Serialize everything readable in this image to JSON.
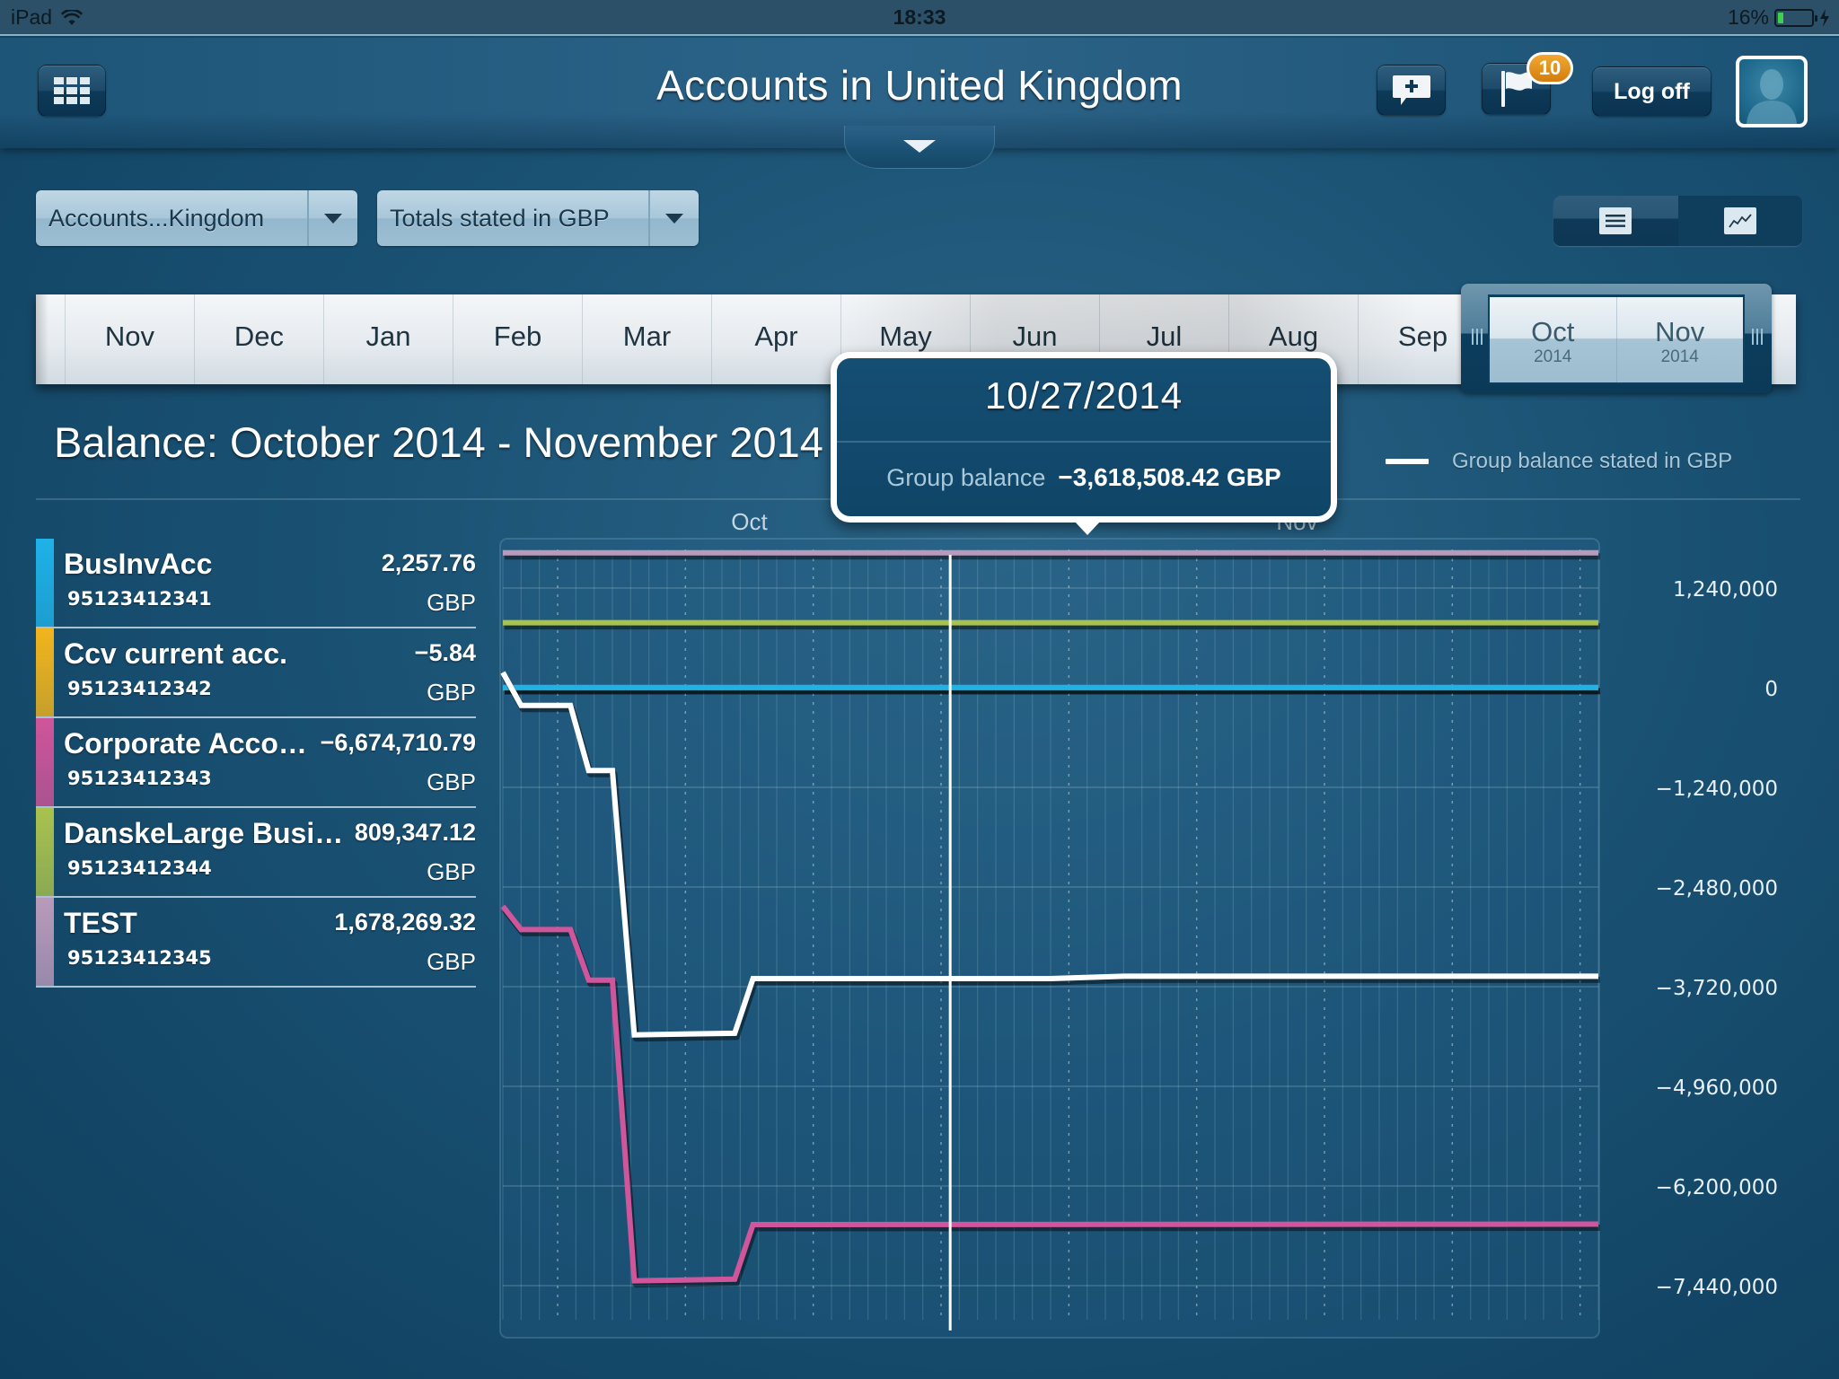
{
  "status_bar": {
    "device": "iPad",
    "time": "18:33",
    "battery_percent_label": "16%",
    "battery_level": 0.16
  },
  "header": {
    "title": "Accounts in United Kingdom",
    "menu_icon": "grid-menu-icon",
    "new_message_icon": "comment-plus-icon",
    "flag_icon": "flag-icon",
    "flag_badge": "10",
    "logoff_label": "Log off",
    "avatar_icon": "user-avatar-icon",
    "pull_tab_icon": "chevron-down-icon"
  },
  "filters": {
    "account_group": "Accounts...Kingdom",
    "currency_mode": "Totals stated in GBP"
  },
  "view_toggle": {
    "options": [
      {
        "name": "list",
        "icon": "list-icon"
      },
      {
        "name": "chart",
        "icon": "line-chart-icon"
      }
    ],
    "selected": "chart"
  },
  "timeline": {
    "months": [
      "Nov",
      "Dec",
      "Jan",
      "Feb",
      "Mar",
      "Apr",
      "May",
      "Jun",
      "Jul",
      "Aug",
      "Sep"
    ],
    "selected": [
      {
        "month": "Oct",
        "year": "2014"
      },
      {
        "month": "Nov",
        "year": "2014"
      }
    ]
  },
  "balance_title": "Balance: October 2014 - November 2014",
  "legend": {
    "label": "Group balance stated in GBP",
    "color": "#ffffff"
  },
  "accounts": [
    {
      "name": "BusInvAcc",
      "number": "95123412341",
      "balance": "2,257.76",
      "currency": "GBP",
      "color": "#1fb2e8"
    },
    {
      "name": "Ccv current acc.",
      "number": "95123412342",
      "balance": "−5.84",
      "currency": "GBP",
      "color": "#f2b51c"
    },
    {
      "name": "Corporate Acco…",
      "number": "95123412343",
      "balance": "−6,674,710.79",
      "currency": "GBP",
      "color": "#d0559a"
    },
    {
      "name": "DanskeLarge Busi…",
      "number": "95123412344",
      "balance": "809,347.12",
      "currency": "GBP",
      "color": "#a9c24e"
    },
    {
      "name": "TEST",
      "number": "95123412345",
      "balance": "1,678,269.32",
      "currency": "GBP",
      "color": "#b99abb"
    }
  ],
  "tooltip": {
    "date": "10/27/2014",
    "label": "Group balance",
    "value": "−3,618,508.42 GBP"
  },
  "chart_data": {
    "type": "line",
    "title": "Balance: October 2014 - November 2014",
    "xlabel": "",
    "ylabel": "",
    "x_tick_labels": [
      "Oct",
      "Nov"
    ],
    "x_unit": "day index from start of visible range",
    "x_range": [
      0,
      60
    ],
    "y_tick_values": [
      1240000,
      0,
      -1240000,
      -2480000,
      -3720000,
      -4960000,
      -6200000,
      -7440000
    ],
    "y_tick_labels": [
      "1,240,000",
      "0",
      "−1,240,000",
      "−2,480,000",
      "−3,720,000",
      "−4,960,000",
      "−6,200,000",
      "−7,440,000"
    ],
    "ylim": [
      -8100000,
      1950000
    ],
    "grid": true,
    "legend_position": "top-right",
    "cursor": {
      "x": 24.5,
      "label": "10/27/2014"
    },
    "series": [
      {
        "name": "TEST",
        "color": "#b99abb",
        "points": [
          [
            0,
            1678269
          ],
          [
            60,
            1678269
          ]
        ]
      },
      {
        "name": "DanskeLarge Busi…",
        "color": "#a9c24e",
        "points": [
          [
            0,
            809347
          ],
          [
            60,
            809347
          ]
        ]
      },
      {
        "name": "Ccv current acc.",
        "color": "#f2b51c",
        "points": [
          [
            0,
            -6
          ],
          [
            60,
            -6
          ]
        ]
      },
      {
        "name": "BusInvAcc",
        "color": "#1fb2e8",
        "points": [
          [
            0,
            2258
          ],
          [
            60,
            2258
          ]
        ]
      },
      {
        "name": "Corporate Acco…",
        "color": "#d0559a",
        "points": [
          [
            0,
            -2720000
          ],
          [
            1,
            -3010000
          ],
          [
            3.7,
            -3010000
          ],
          [
            4.7,
            -3640000
          ],
          [
            6,
            -3640000
          ],
          [
            7.2,
            -7380000
          ],
          [
            12.7,
            -7360000
          ],
          [
            13.7,
            -6680000
          ],
          [
            60,
            -6674711
          ]
        ]
      },
      {
        "name": "Group balance stated in GBP",
        "color": "#ffffff",
        "points": [
          [
            0,
            190000
          ],
          [
            1,
            -220000
          ],
          [
            3.7,
            -220000
          ],
          [
            4.7,
            -1030000
          ],
          [
            6,
            -1030000
          ],
          [
            7.2,
            -4320000
          ],
          [
            12.7,
            -4300000
          ],
          [
            13.7,
            -3620000
          ],
          [
            30,
            -3620000
          ],
          [
            34,
            -3590000
          ],
          [
            60,
            -3590000
          ]
        ]
      }
    ]
  }
}
